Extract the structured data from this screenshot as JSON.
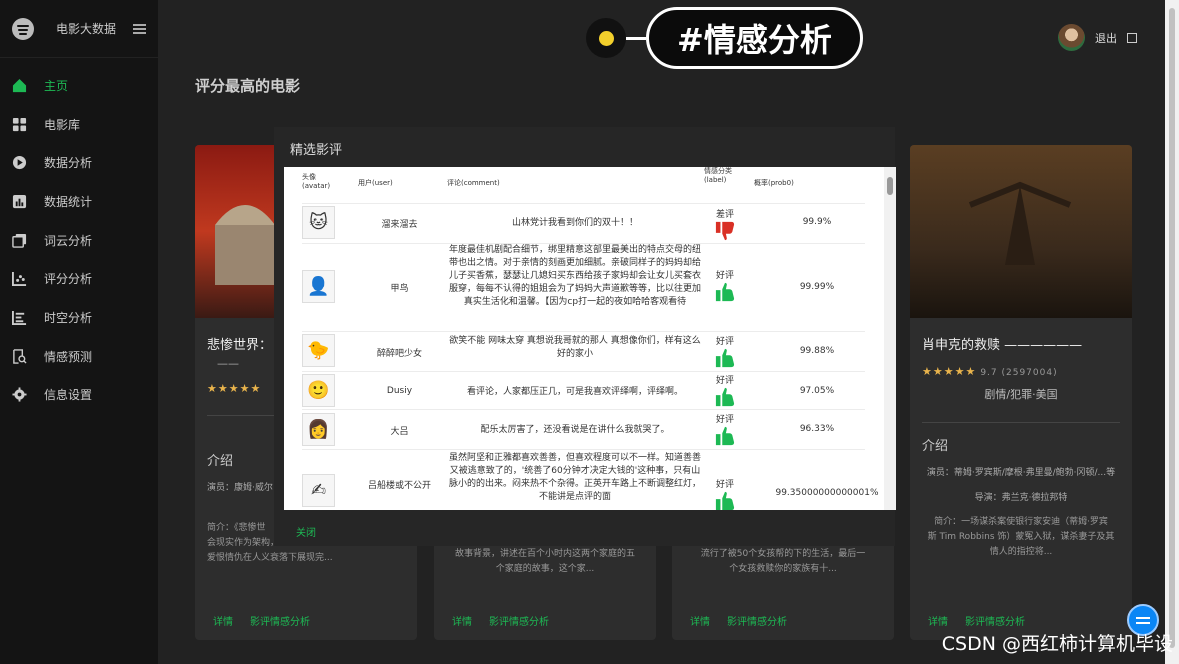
{
  "sidebar": {
    "brand": "电影大数据",
    "items": [
      {
        "label": "主页",
        "active": true
      },
      {
        "label": "电影库"
      },
      {
        "label": "数据分析"
      },
      {
        "label": "数据统计"
      },
      {
        "label": "词云分析"
      },
      {
        "label": "评分分析"
      },
      {
        "label": "时空分析"
      },
      {
        "label": "情感预测"
      },
      {
        "label": "信息设置"
      }
    ]
  },
  "header": {
    "logout": "退出"
  },
  "sticker": {
    "label": "#情感分析"
  },
  "page": {
    "title": "评分最高的电影"
  },
  "cards": [
    {
      "title": "悲惨世界：",
      "subtitle": "——",
      "intro": "介绍",
      "cast": "演员：康姆·威尔",
      "synopsis_1": "简介：《悲惨世",
      "synopsis_2": "会现实作为架构，法国大革命背景下小人物的",
      "synopsis_3": "爱恨情仇在人义衰落下展现完...",
      "link_detail": "详情",
      "link_sentiment": "影评情感分析"
    },
    {
      "synopsis_2": "故事背景，讲述在百个小时内这两个家庭的五",
      "synopsis_3": "个家庭的故事，这个家...",
      "link_detail": "详情",
      "link_sentiment": "影评情感分析"
    },
    {
      "synopsis_2": "流行了被50个女孩帮的下的生活，最后一",
      "synopsis_3": "个女孩救赎你的家族有十...",
      "link_detail": "详情",
      "link_sentiment": "影评情感分析"
    },
    {
      "title": "肖申克的救赎 ——————",
      "rating": "9.7 (2597004)",
      "genre": "剧情/犯罪·美国",
      "intro": "介绍",
      "cast": "演员：蒂姆·罗宾斯/摩根·弗里曼/鲍勃·冈顿/...等",
      "director": "导演：弗兰克·德拉邦特",
      "synopsis_1": "简介：一场谋杀案使银行家安迪（蒂姆·罗宾",
      "synopsis_2": "斯 Tim Robbins 饰）蒙冤入狱，谋杀妻子及其",
      "synopsis_3": "情人的指控将...",
      "link_detail": "详情",
      "link_sentiment": "影评情感分析"
    }
  ],
  "modal": {
    "title": "精选影评",
    "headers": {
      "avatar": "头像 (avatar)",
      "user": "用户(user)",
      "comment": "评论(comment)",
      "label": "情感分类 (label)",
      "prob": "概率(prob0)"
    },
    "rows": [
      {
        "user": "溜来溜去",
        "comment": "山林党计我看到你们的双十！！",
        "label": "差评",
        "prob": "99.9%"
      },
      {
        "user": "甲鸟",
        "comment": "年度最佳机剧配合细节，绑里精意这部里最美出的特点交母的纽带也出之情。对于亲情的刻画更加细腻。亲破同样子的妈妈却给儿子买香蕉，瑟瑟让几媳妇买东西给孩子家妈却会让女儿买套衣服穿，每每不认得的姐姐会为了妈妈大声道歉等等，比以往更加真实生活化和温馨。【因为cp打一起的夜如哈哈客观看待",
        "label": "好评",
        "prob": "99.99%"
      },
      {
        "user": "醉醉吧少女",
        "comment": "欲笑不能 网味太穿 真想说我哥就的那人 真想像你们，样有这么好的家小",
        "label": "好评",
        "prob": "99.88%"
      },
      {
        "user": "Dusiy",
        "comment": "看评论，人家都压正几，可是我喜欢评绎啊，评绎啊。",
        "label": "好评",
        "prob": "97.05%"
      },
      {
        "user": "大吕",
        "comment": "配乐太厉害了，还没看说是在讲什么我就哭了。",
        "label": "好评",
        "prob": "96.33%"
      },
      {
        "user": "吕船楼或不公开",
        "comment": "虽然阿坚和正雅都喜欢善善，但喜欢程度可以不一样。知道善善又被逃意致了的，'统善了60分钟才决定大钱的'这种事，只有山脉小的的出来。闷来热不个杂得。正英开车路上不断调整红灯，不能讲是点评的面",
        "label": "好评",
        "prob": "99.35000000000001%"
      }
    ],
    "close": "关闭"
  },
  "watermark": "CSDN @西红柿计算机毕设",
  "colors": {
    "accent": "#1db954",
    "negative": "#d93025",
    "star": "#e9b44c"
  }
}
